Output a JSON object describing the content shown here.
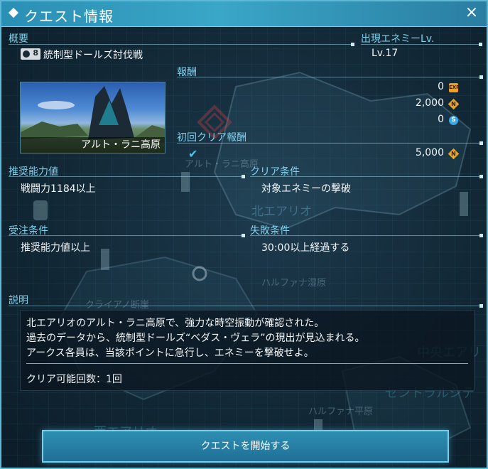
{
  "window": {
    "title": "クエスト情報",
    "close_label": "×"
  },
  "overview": {
    "label": "概要",
    "party_count": "8",
    "quest_name": "統制型ドールズ討伐戦"
  },
  "enemy_level": {
    "label": "出現エネミーLv.",
    "value": "Lv.17"
  },
  "rewards": {
    "label": "報酬",
    "items": [
      {
        "value": "0",
        "icon_text": "EXP",
        "icon": "exp-icon"
      },
      {
        "value": "2,000",
        "icon_text": "N",
        "icon": "meseta-icon"
      },
      {
        "value": "0",
        "icon_text": "S",
        "icon": "star-gem-icon"
      }
    ]
  },
  "first_clear": {
    "label": "初回クリア報酬",
    "value": "5,000",
    "icon_text": "N",
    "icon": "meseta-icon",
    "check": "✔"
  },
  "thumbnail": {
    "caption": "アルト・ラニ高原"
  },
  "recommended_power": {
    "label": "推奨能力値",
    "value": "戦闘力1184以上"
  },
  "clear_condition": {
    "label": "クリア条件",
    "value": "対象エネミーの撃破"
  },
  "order_condition": {
    "label": "受注条件",
    "value": "推奨能力値以上"
  },
  "failure_condition": {
    "label": "失敗条件",
    "value": "30:00以上経過する"
  },
  "description": {
    "label": "説明",
    "lines": [
      "北エアリオのアルト・ラニ高原で、強力な時空振動が確認された。",
      "過去のデータから、統制型ドールズ“ベダス・ヴェラ”の現出が見込まれる。",
      "アークス各員は、当該ポイントに急行し、エネミーを撃破せよ。"
    ],
    "clear_count": "クリア可能回数：1回"
  },
  "start_button": {
    "label": "クエストを開始する"
  },
  "map_labels": [
    "アルト・ラニ高原",
    "北エアリオ",
    "ハルファナ湿原",
    "クライアノ断崖",
    "中央エアリ",
    "セントラルシテ",
    "ハルファナ平原",
    "西エアリオ"
  ],
  "colors": {
    "accent": "#5fb8d6",
    "label": "#7fd0ec",
    "title_bar": "#3aa6c8"
  }
}
